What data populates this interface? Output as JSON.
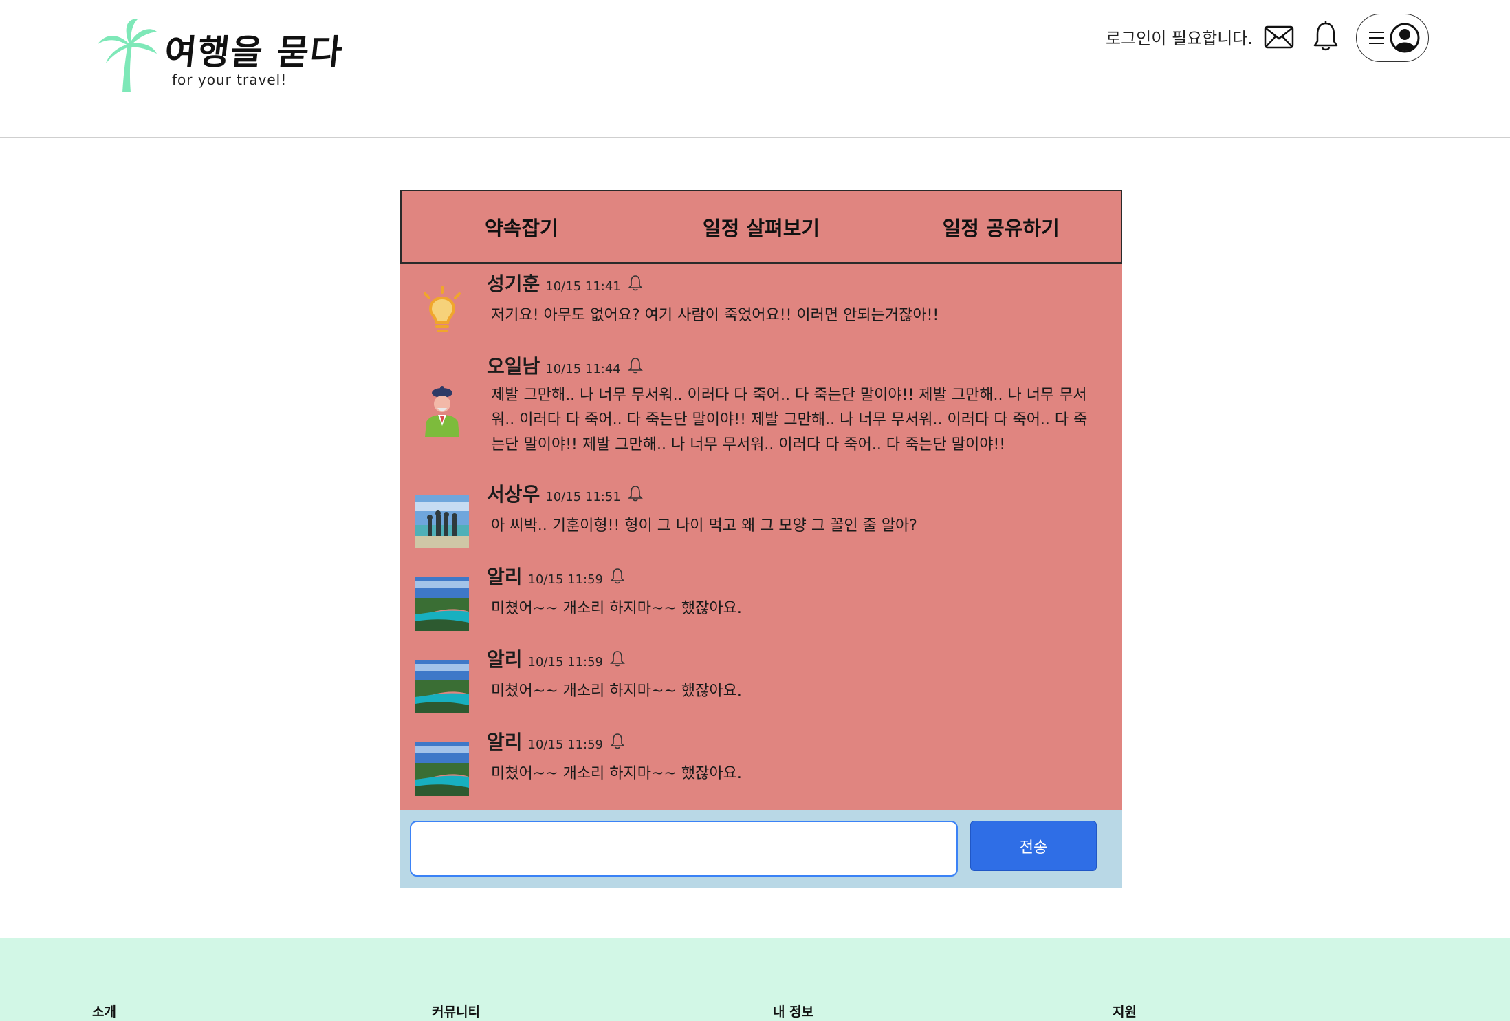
{
  "header": {
    "logo_title": "여행을 묻다",
    "logo_subtitle": "for your travel!",
    "login_message": "로그인이 필요합니다."
  },
  "tabs": [
    {
      "label": "약속잡기"
    },
    {
      "label": "일정 살펴보기"
    },
    {
      "label": "일정 공유하기"
    }
  ],
  "messages": [
    {
      "name": "성기훈",
      "time": "10/15 11:41",
      "avatar": "lightbulb-avatar",
      "text": "저기요! 아무도 없어요? 여기 사람이 죽었어요!! 이러면 안되는거잖아!!"
    },
    {
      "name": "오일남",
      "time": "10/15 11:44",
      "avatar": "person-avatar",
      "text": "제발 그만해.. 나 너무 무서워.. 이러다 다 죽어.. 다 죽는단 말이야!! 제발 그만해.. 나 너무 무서워.. 이러다 다 죽어.. 다 죽는단 말이야!! 제발 그만해.. 나 너무 무서워.. 이러다 다 죽어.. 다 죽는단 말이야!! 제발 그만해.. 나 너무 무서워.. 이러다 다 죽어.. 다 죽는단 말이야!!"
    },
    {
      "name": "서상우",
      "time": "10/15 11:51",
      "avatar": "beach-photo-avatar",
      "text": "아 씨박.. 기훈이형!! 형이 그 나이 먹고 왜 그 모양 그 꼴인 줄 알아?"
    },
    {
      "name": "알리",
      "time": "10/15 11:59",
      "avatar": "island-photo-avatar",
      "text": "미쳤어~~ 개소리 하지마~~ 했잖아요."
    },
    {
      "name": "알리",
      "time": "10/15 11:59",
      "avatar": "island-photo-avatar",
      "text": "미쳤어~~ 개소리 하지마~~ 했잖아요."
    },
    {
      "name": "알리",
      "time": "10/15 11:59",
      "avatar": "island-photo-avatar",
      "text": "미쳤어~~ 개소리 하지마~~ 했잖아요."
    }
  ],
  "input": {
    "value": "",
    "send_label": "전송"
  },
  "footer": {
    "columns": [
      "소개",
      "커뮤니티",
      "내 정보",
      "지원"
    ]
  },
  "colors": {
    "chat_background": "#e08580",
    "input_bar_background": "#b9d8e6",
    "send_button": "#2f6ee6",
    "footer_background": "#d2f7e6",
    "logo_palm": "#7ee8b8"
  }
}
